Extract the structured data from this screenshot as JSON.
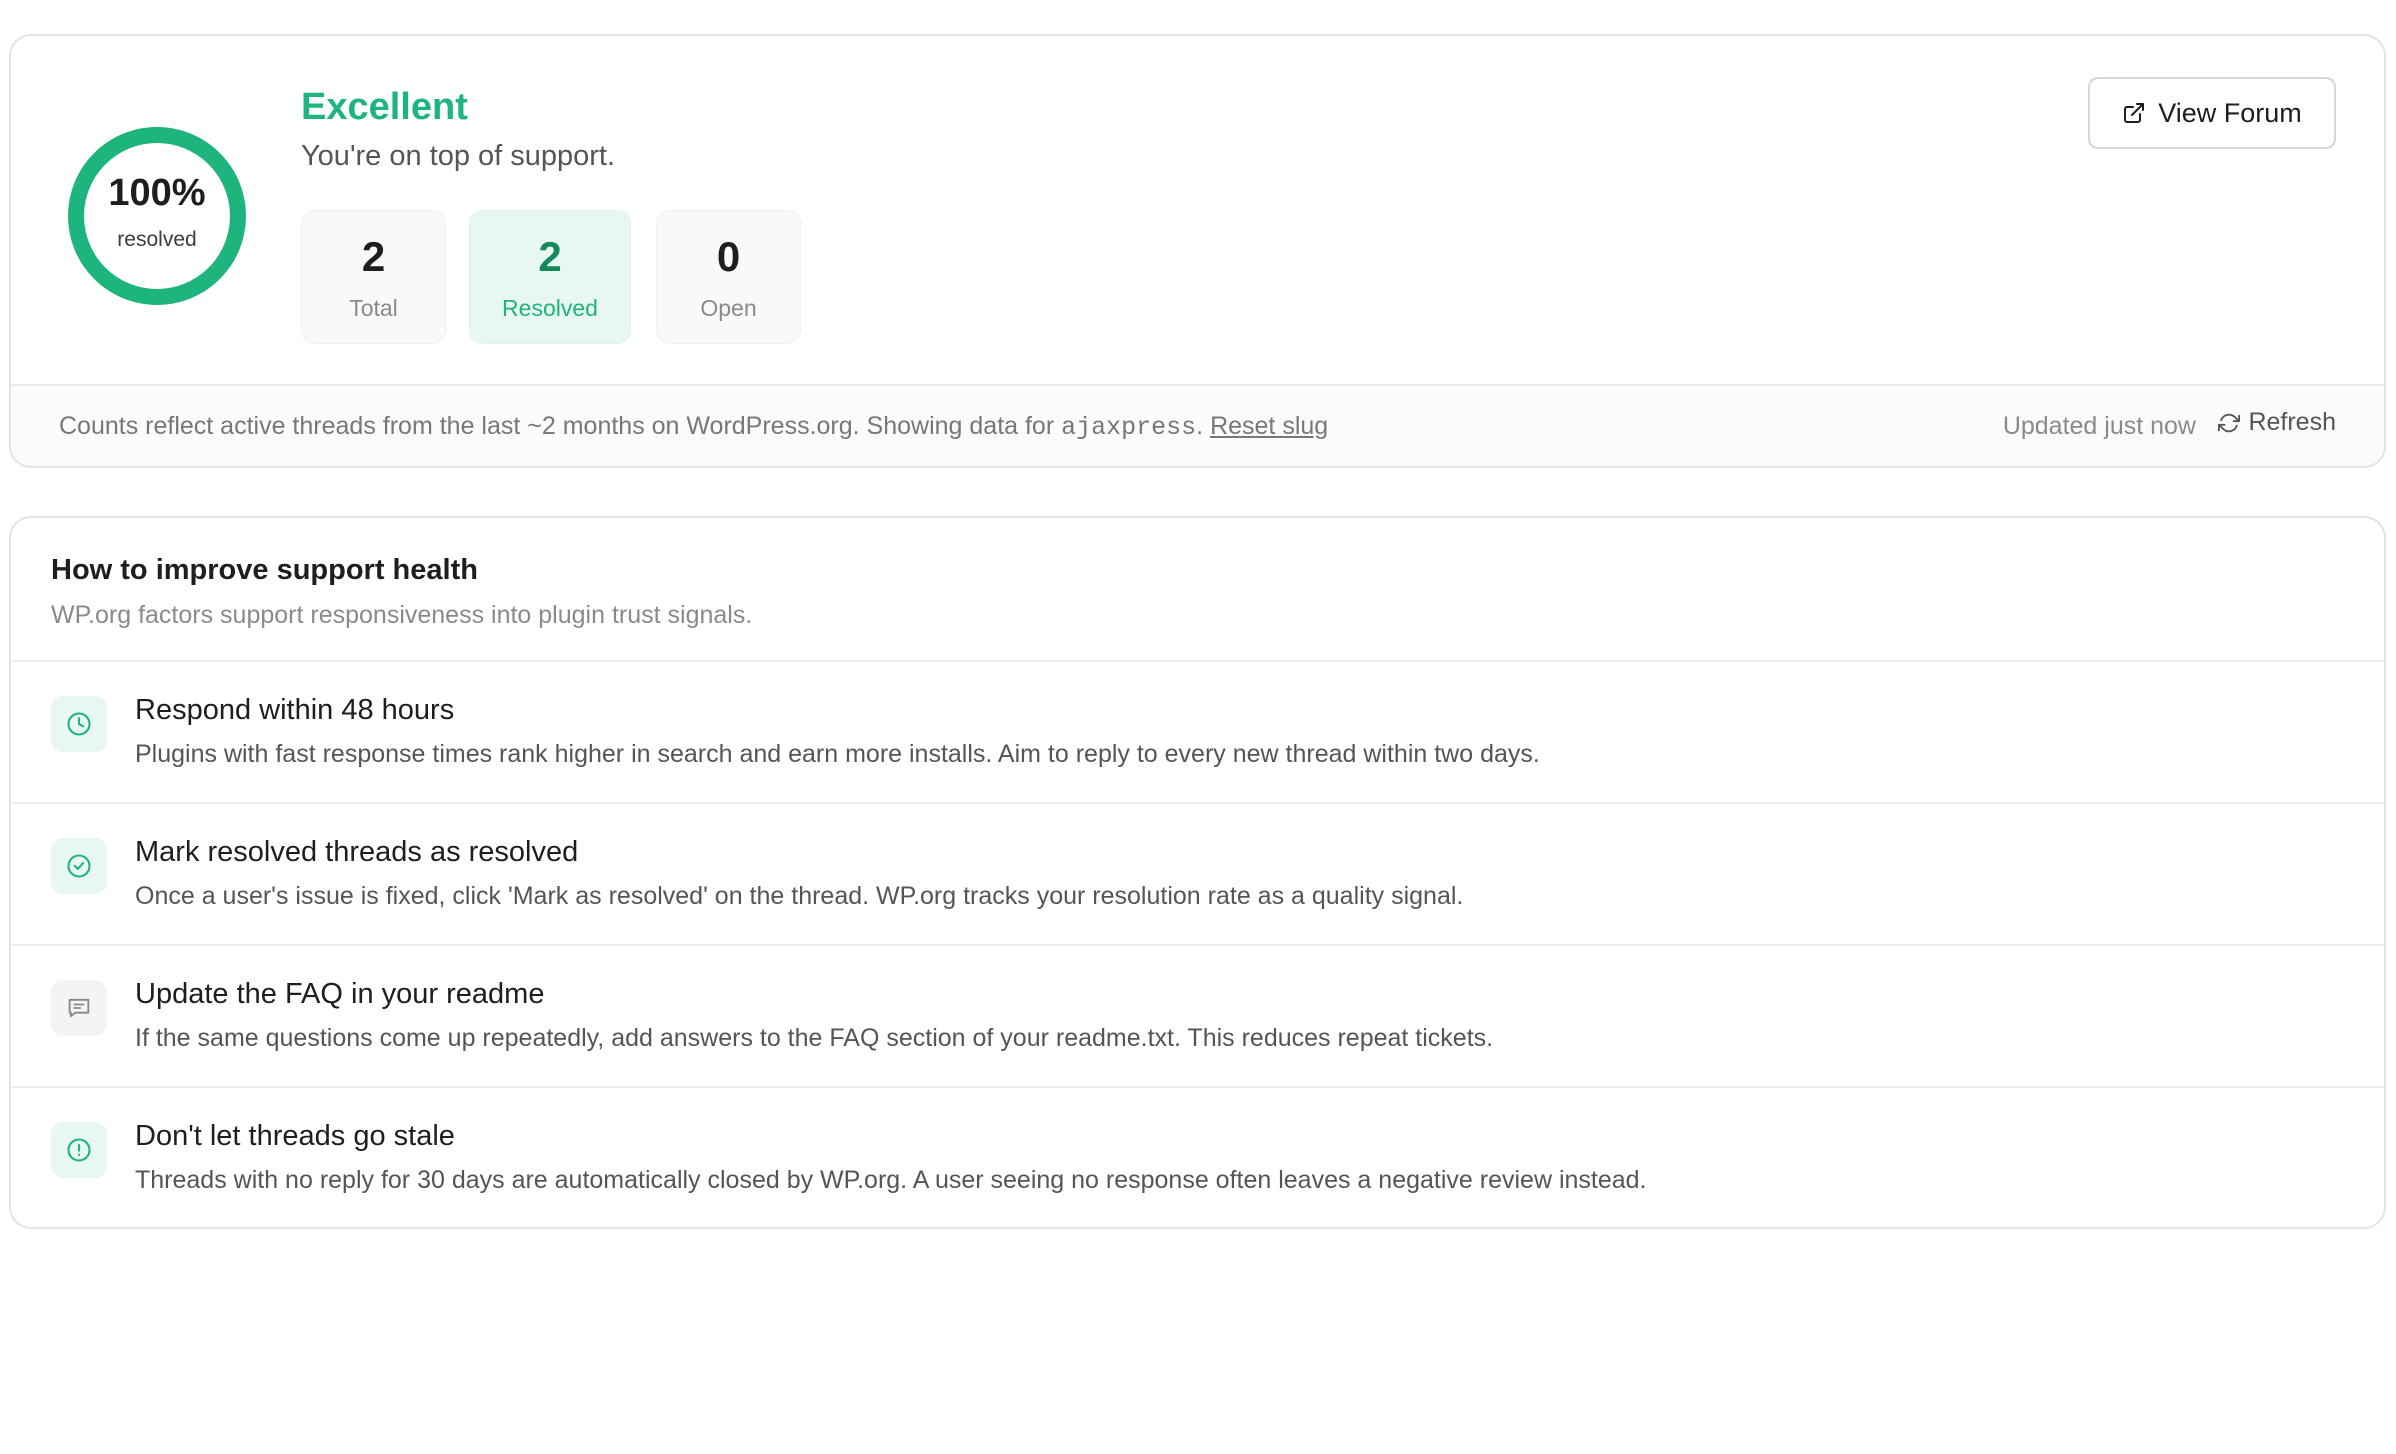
{
  "health": {
    "percent_label": "100%",
    "percent_value": 100,
    "percent_sub": "resolved",
    "rating": "Excellent",
    "message": "You're on top of support.",
    "stats": [
      {
        "value": "2",
        "label": "Total"
      },
      {
        "value": "2",
        "label": "Resolved"
      },
      {
        "value": "0",
        "label": "Open"
      }
    ],
    "view_forum_label": "View Forum",
    "note_prefix": "Counts reflect active threads from the last ~2 months on WordPress.org. Showing data for ",
    "slug": "ajaxpress",
    "note_suffix": ".",
    "reset_label": "Reset slug",
    "updated_label": "Updated just now",
    "refresh_label": "Refresh"
  },
  "colors": {
    "accent": "#1db47d",
    "accent_dark": "#138a5e",
    "accent_bg": "#e8f8f0"
  },
  "tips": {
    "title": "How to improve support health",
    "subtitle": "WP.org factors support responsiveness into plugin trust signals.",
    "items": [
      {
        "icon": "clock-icon",
        "title": "Respond within 48 hours",
        "desc": "Plugins with fast response times rank higher in search and earn more installs. Aim to reply to every new thread within two days."
      },
      {
        "icon": "check-circle-icon",
        "title": "Mark resolved threads as resolved",
        "desc": "Once a user's issue is fixed, click 'Mark as resolved' on the thread. WP.org tracks your resolution rate as a quality signal."
      },
      {
        "icon": "chat-bubble-icon",
        "title": "Update the FAQ in your readme",
        "desc": "If the same questions come up repeatedly, add answers to the FAQ section of your readme.txt. This reduces repeat tickets."
      },
      {
        "icon": "alert-circle-icon",
        "title": "Don't let threads go stale",
        "desc": "Threads with no reply for 30 days are automatically closed by WP.org. A user seeing no response often leaves a negative review instead."
      }
    ]
  }
}
